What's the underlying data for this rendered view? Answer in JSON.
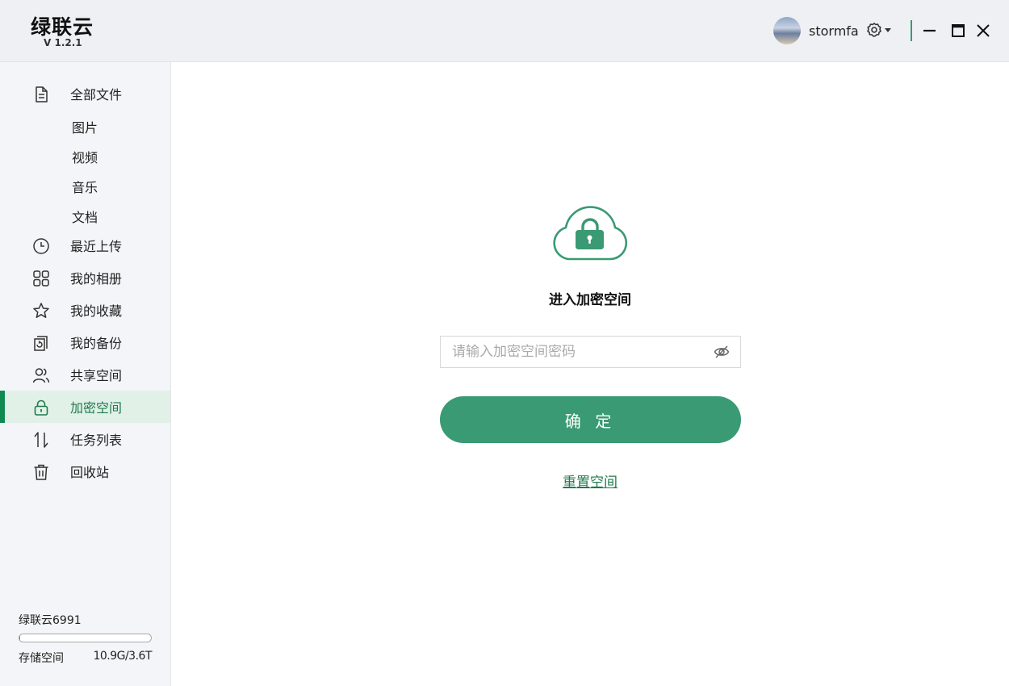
{
  "app": {
    "name": "绿联云",
    "version": "V 1.2.1"
  },
  "user": {
    "name": "stormfa"
  },
  "icons": {
    "settings": "gear-icon",
    "minimize": "minimize-icon",
    "maximize": "maximize-icon",
    "close": "close-icon",
    "lock": "cloud-lock-icon",
    "eye": "eye-off-icon"
  },
  "sidebar": {
    "items": [
      {
        "label": "全部文件",
        "icon": "file-icon"
      },
      {
        "label": "最近上传",
        "icon": "clock-icon"
      },
      {
        "label": "我的相册",
        "icon": "grid-icon"
      },
      {
        "label": "我的收藏",
        "icon": "star-icon"
      },
      {
        "label": "我的备份",
        "icon": "backup-icon"
      },
      {
        "label": "共享空间",
        "icon": "users-icon"
      },
      {
        "label": "加密空间",
        "icon": "lock-icon",
        "active": true
      },
      {
        "label": "任务列表",
        "icon": "transfer-icon"
      },
      {
        "label": "回收站",
        "icon": "trash-icon"
      }
    ],
    "subitems": [
      "图片",
      "视频",
      "音乐",
      "文档"
    ],
    "device": "绿联云6991",
    "storage": {
      "label": "存储空间",
      "value": "10.9G/3.6T",
      "used_fraction": 0.003
    }
  },
  "main": {
    "title": "进入加密空间",
    "password_placeholder": "请输入加密空间密码",
    "confirm_label": "确 定",
    "reset_label": "重置空间"
  },
  "colors": {
    "accent": "#3a9a73",
    "active_bar": "#118a52",
    "active_bg": "#e1f1e8"
  }
}
